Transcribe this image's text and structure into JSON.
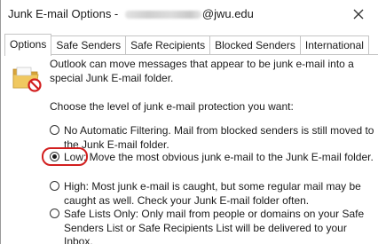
{
  "window": {
    "title_prefix": "Junk E-mail Options - ",
    "title_suffix": "@jwu.edu",
    "close_glyph": "✕"
  },
  "tabs": [
    {
      "label": "Options",
      "active": true
    },
    {
      "label": "Safe Senders",
      "active": false
    },
    {
      "label": "Safe Recipients",
      "active": false
    },
    {
      "label": "Blocked Senders",
      "active": false
    },
    {
      "label": "International",
      "active": false
    }
  ],
  "options_page": {
    "icon": "junk-folder-blocked-icon",
    "intro": "Outlook can move messages that appear to be junk e-mail into a special Junk E-mail folder.",
    "prompt": "Choose the level of junk e-mail protection you want:",
    "levels": [
      {
        "label": "No Automatic Filtering. Mail from blocked senders is still moved to the Junk E-mail folder.",
        "selected": false
      },
      {
        "label": "Low: Move the most obvious junk e-mail to the Junk E-mail folder.",
        "selected": true
      },
      {
        "label": "High: Most junk e-mail is caught, but some regular mail may be caught as well. Check your Junk E-mail folder often.",
        "selected": false
      },
      {
        "label": "Safe Lists Only: Only mail from people or domains on your Safe Senders List or Safe Recipients List will be delivered to your Inbox.",
        "selected": false
      }
    ]
  },
  "colors": {
    "annotation_highlight": "#d21f1f",
    "folder": "#e8b84a",
    "block_symbol": "#d21f1f"
  }
}
